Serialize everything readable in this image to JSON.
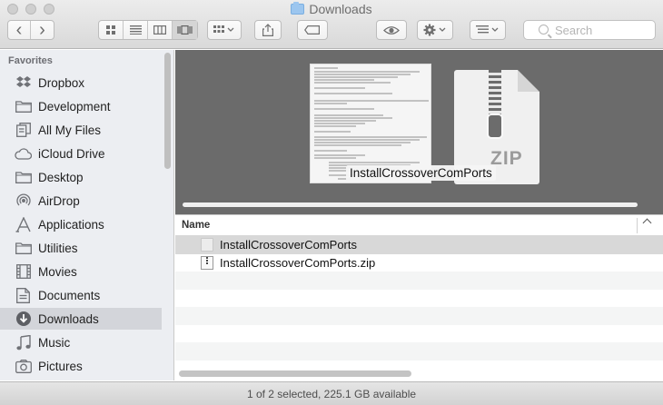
{
  "window": {
    "title": "Downloads"
  },
  "toolbar": {
    "back": "‹",
    "forward": "›",
    "search_placeholder": "Search"
  },
  "sidebar": {
    "heading": "Favorites",
    "items": [
      {
        "label": "Dropbox",
        "icon": "dropbox-icon"
      },
      {
        "label": "Development",
        "icon": "folder-icon"
      },
      {
        "label": "All My Files",
        "icon": "all-files-icon"
      },
      {
        "label": "iCloud Drive",
        "icon": "cloud-icon"
      },
      {
        "label": "Desktop",
        "icon": "desktop-icon"
      },
      {
        "label": "AirDrop",
        "icon": "airdrop-icon"
      },
      {
        "label": "Applications",
        "icon": "applications-icon"
      },
      {
        "label": "Utilities",
        "icon": "folder-icon"
      },
      {
        "label": "Movies",
        "icon": "movies-icon"
      },
      {
        "label": "Documents",
        "icon": "documents-icon"
      },
      {
        "label": "Downloads",
        "icon": "downloads-icon",
        "selected": true
      },
      {
        "label": "Music",
        "icon": "music-icon"
      },
      {
        "label": "Pictures",
        "icon": "pictures-icon"
      }
    ]
  },
  "preview": {
    "label": "InstallCrossoverComPorts",
    "zip_badge": "ZIP"
  },
  "list": {
    "column_name": "Name",
    "rows": [
      {
        "name": "InstallCrossoverComPorts",
        "selected": true,
        "icon": "generic-file-icon"
      },
      {
        "name": "InstallCrossoverComPorts.zip",
        "selected": false,
        "icon": "zip-file-icon"
      }
    ]
  },
  "status": {
    "text": "1 of 2 selected, 225.1 GB available"
  }
}
